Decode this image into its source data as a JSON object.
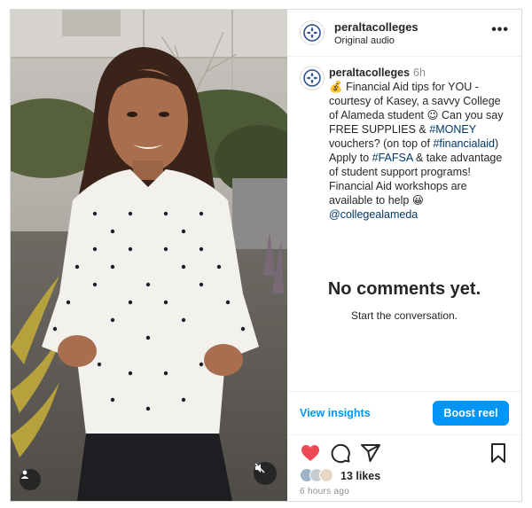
{
  "post": {
    "username": "peraltacolleges",
    "audio": "Original audio",
    "more_icon": "more-horizontal-icon",
    "caption": {
      "username": "peraltacolleges",
      "time": "6h",
      "emoji_money": "💰",
      "text_1": "Financial Aid tips for YOU - courtesy of Kasey, a savvy College of Alameda student",
      "emoji_wink": "😉",
      "text_2": "Can you say FREE SUPPLIES &",
      "tag_money": "#MONEY",
      "text_3": "vouchers? (on top of",
      "tag_financialaid": "#financialaid",
      "text_4": ") Apply to",
      "tag_fafsa": "#FAFSA",
      "text_5": "& take advantage of student support programs! Financial Aid workshops are available to help",
      "emoji_smile": "😀",
      "mention": "@collegealameda"
    },
    "no_comments_title": "No comments yet.",
    "no_comments_sub": "Start the conversation.",
    "view_insights": "View insights",
    "boost_reel": "Boost reel",
    "likes": "13 likes",
    "timestamp": "6 hours ago",
    "colors": {
      "link": "#00376b",
      "accent": "#0095f6",
      "like": "#ed4956"
    }
  }
}
